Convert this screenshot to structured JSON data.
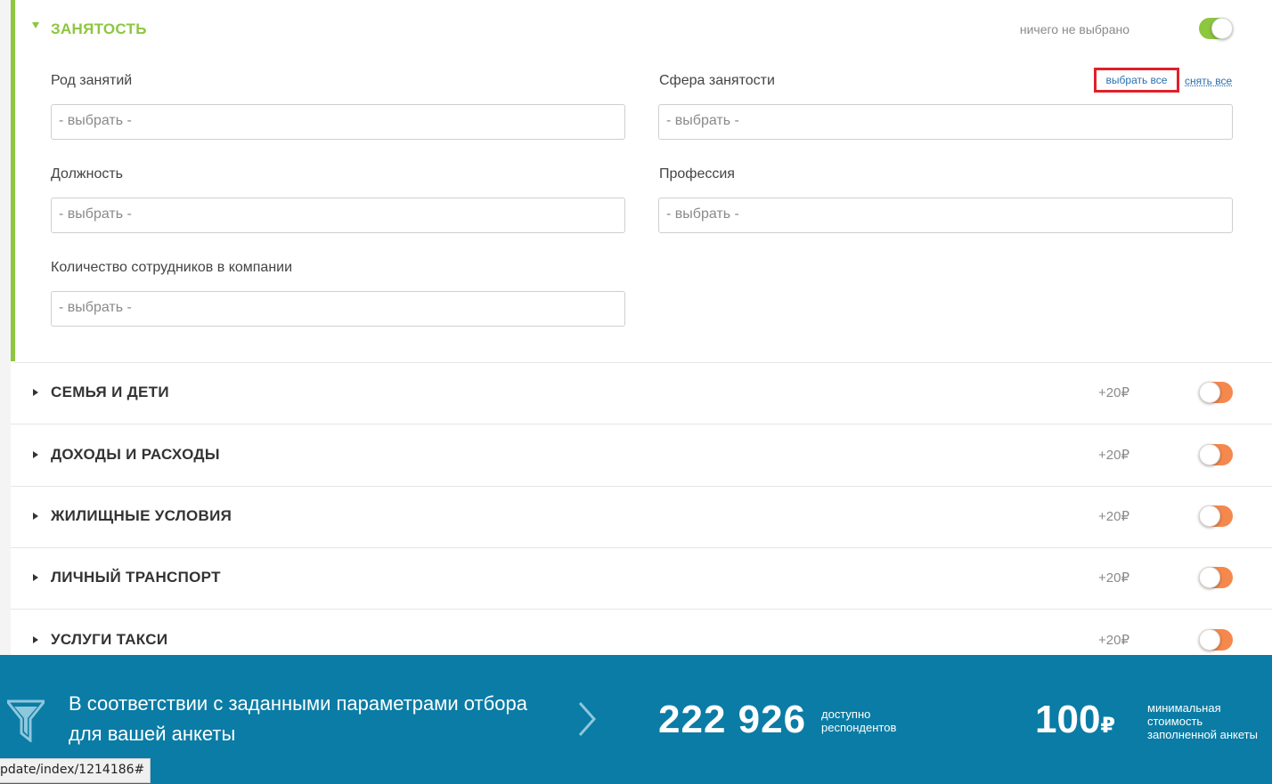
{
  "open_section": {
    "title": "ЗАНЯТОСТЬ",
    "status": "ничего не выбрано",
    "fields": [
      {
        "label": "Род занятий",
        "placeholder": "- выбрать -"
      },
      {
        "label": "Сфера занятости",
        "placeholder": "- выбрать -"
      },
      {
        "label": "Должность",
        "placeholder": "- выбрать -"
      },
      {
        "label": "Профессия",
        "placeholder": "- выбрать -"
      },
      {
        "label": "Количество сотрудников в компании",
        "placeholder": "- выбрать -"
      }
    ],
    "select_all": "выбрать все",
    "clear_all": "снять все"
  },
  "sections": [
    {
      "title": "СЕМЬЯ И ДЕТИ",
      "price": "+20₽"
    },
    {
      "title": "ДОХОДЫ И РАСХОДЫ",
      "price": "+20₽"
    },
    {
      "title": "ЖИЛИЩНЫЕ УСЛОВИЯ",
      "price": "+20₽"
    },
    {
      "title": "ЛИЧНЫЙ ТРАНСПОРТ",
      "price": "+20₽"
    },
    {
      "title": "УСЛУГИ ТАКСИ",
      "price": "+20₽"
    }
  ],
  "footer": {
    "text": "В соответствии с заданными параметрами отбора для вашей анкеты",
    "respondents": "222 926",
    "respondents_caption": "доступно респондентов",
    "price": "100",
    "currency": "₽",
    "price_caption": "минимальная стоимость заполненной анкеты"
  },
  "status_bar_url": "pdate/index/1214186#",
  "colors": {
    "accent_green": "#8dc63f",
    "toggle_off": "#f5884d",
    "footer_bg": "#0a7ca5",
    "highlight": "#e0202a"
  }
}
